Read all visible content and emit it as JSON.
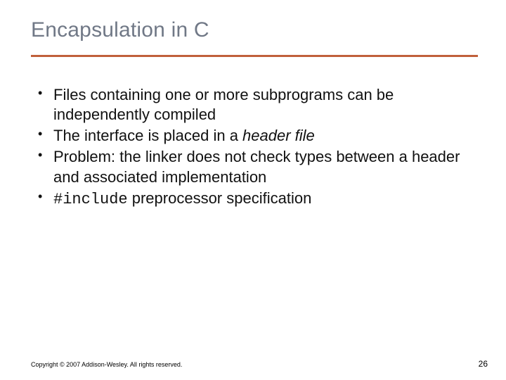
{
  "title": "Encapsulation in C",
  "bullets": [
    {
      "pre": "Files containing one or more subprograms can be independently compiled",
      "em": "",
      "post": ""
    },
    {
      "pre": "The interface is placed in a ",
      "em": "header file",
      "post": ""
    },
    {
      "pre": "Problem: the linker does not check types between a header and associated implementation",
      "em": "",
      "post": ""
    },
    {
      "pre": "",
      "mono": "#include",
      "post": " preprocessor specification"
    }
  ],
  "footer": {
    "copyright": "Copyright © 2007 Addison-Wesley. All rights reserved.",
    "page": "26"
  }
}
